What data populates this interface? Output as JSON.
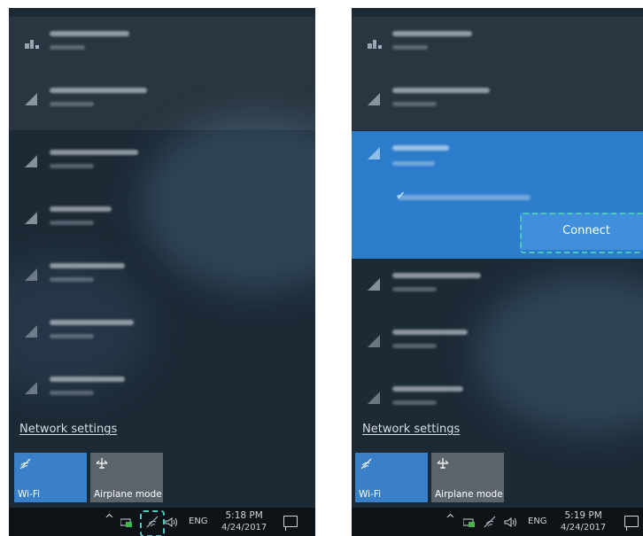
{
  "left": {
    "network_settings_label": "Network settings",
    "tiles": {
      "wifi_label": "Wi-Fi",
      "airplane_label": "Airplane mode"
    },
    "taskbar": {
      "chevron": "^",
      "language": "ENG",
      "time": "5:18 PM",
      "date": "4/24/2017"
    },
    "networks_shown": 7
  },
  "right": {
    "network_settings_label": "Network settings",
    "tiles": {
      "wifi_label": "Wi-Fi",
      "airplane_label": "Airplane mode"
    },
    "connect_label": "Connect",
    "taskbar": {
      "chevron": "^",
      "language": "ENG",
      "time": "5:19 PM",
      "date": "4/24/2017"
    },
    "networks_shown": 7
  },
  "colors": {
    "panel_bg": "#1c2a36",
    "accent_blue": "#2c7ccc",
    "tile_wifi": "#3a80c8",
    "tile_airplane": "#5b636b",
    "highlight": "#4fc7c1"
  },
  "icons": {
    "network": "wifi-signal-icon",
    "airplane": "airplane-icon",
    "action_center": "action-center-icon",
    "volume": "volume-icon"
  }
}
